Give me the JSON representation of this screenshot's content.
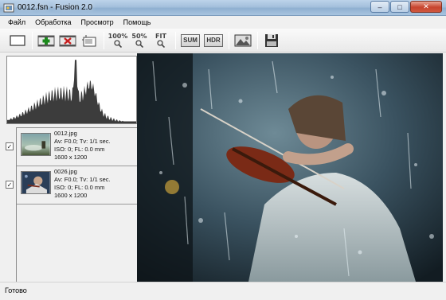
{
  "window": {
    "title": "0012.fsn - Fusion 2.0",
    "minimize_glyph": "–",
    "maximize_glyph": "□",
    "close_glyph": "✕"
  },
  "menu": {
    "items": [
      "Файл",
      "Обработка",
      "Просмотр",
      "Помощь"
    ]
  },
  "toolbar": {
    "zoom_100": "100%",
    "zoom_50": "50%",
    "zoom_fit": "FIT",
    "sum_label": "SUM",
    "hdr_label": "HDR"
  },
  "files": [
    {
      "name": "0012.jpg",
      "exposure": "Av: F0.0; Tv: 1/1 sec.",
      "iso": "ISO: 0; FL: 0.0 mm",
      "size": "1600 x 1200",
      "checked": "✓"
    },
    {
      "name": "0026.jpg",
      "exposure": "Av: F0.0; Tv: 1/1 sec.",
      "iso": "ISO: 0; FL: 0.0 mm",
      "size": "1600 x 1200",
      "checked": "✓"
    }
  ],
  "status": {
    "text": "Готово"
  },
  "colors": {
    "histogram_fill": "#3c3c3c",
    "accent_green": "#1c8a1c",
    "accent_red": "#c82020"
  }
}
